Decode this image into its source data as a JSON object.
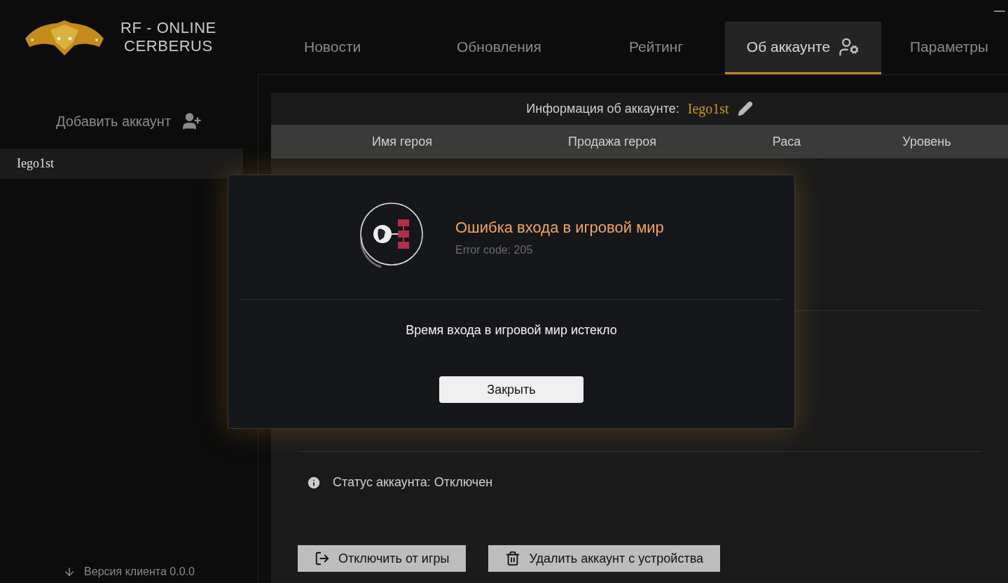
{
  "logo": {
    "line1": "RF - ONLINE",
    "line2": "CERBERUS"
  },
  "tabs": [
    {
      "label": "Новости",
      "selected": false
    },
    {
      "label": "Обновления",
      "selected": false
    },
    {
      "label": "Рейтинг",
      "selected": false
    },
    {
      "label": "Об аккаунте",
      "selected": true
    },
    {
      "label": "Параметры",
      "selected": false
    }
  ],
  "sidebar": {
    "add_account": "Добавить аккаунт",
    "accounts": [
      {
        "name": "Iego1st",
        "selected": true
      }
    ],
    "version": "Версия клиента 0.0.0"
  },
  "account": {
    "info_label": "Информация об аккаунте:",
    "username": "Iego1st",
    "columns": [
      "Имя героя",
      "Продажа героя",
      "Раса",
      "Уровень"
    ],
    "status": "Статус аккаунта: Отключен",
    "buttons": [
      {
        "kind": "disconnect",
        "label": "Отключить от игры"
      },
      {
        "kind": "delete",
        "label": "Удалить аккаунт с устройства"
      }
    ]
  },
  "dialog": {
    "title": "Ошибка входа в игровой мир",
    "code": "Error code: 205",
    "message": "Время входа в игровой мир истекло",
    "button": "Закрыть"
  }
}
